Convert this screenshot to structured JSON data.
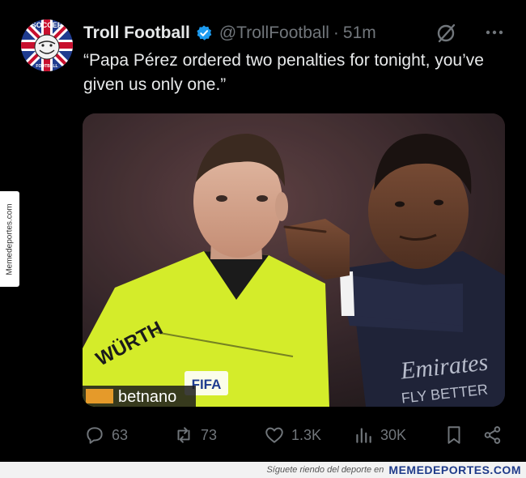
{
  "tweet": {
    "display_name": "Troll Football",
    "handle": "@TrollFootball",
    "separator": "·",
    "time": "51m",
    "text": "“Papa Pérez ordered two penalties for tonight, you’ve given us only one.”"
  },
  "avatar": {
    "top_text": "SOCCER",
    "bottom_text": "FOOTBALL"
  },
  "photo": {
    "ad_brand": "betnano",
    "sponsor_left": "WÜRTH",
    "badge": "FIFA",
    "shirt_sponsor": "Emirates",
    "shirt_sponsor_line2": "FLY BETTER"
  },
  "actions": {
    "replies": "63",
    "reposts": "73",
    "likes": "1.3K",
    "views": "30K"
  },
  "watermark": {
    "side": "Memedeportes.com",
    "footer_text": "Síguete riendo del deporte en",
    "footer_brand": "MEMEDEPORTES.COM"
  },
  "colors": {
    "background": "#000000",
    "text": "#e7e9ea",
    "muted": "#71767b",
    "verified": "#1d9bf0",
    "referee_shirt": "#d4ec2a"
  }
}
